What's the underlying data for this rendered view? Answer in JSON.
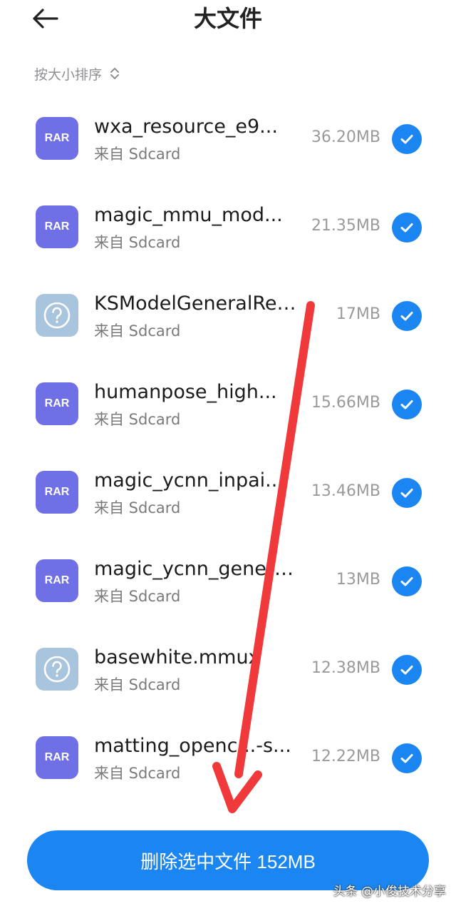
{
  "header": {
    "title": "大文件",
    "back_icon": "arrow-left-icon"
  },
  "sort": {
    "label": "按大小排序",
    "icon": "sort-updown-icon"
  },
  "files": [
    {
      "name": "wxa_resource_e9...",
      "source": "来自 Sdcard",
      "size": "36.20MB",
      "type": "rar",
      "icon_label": "RAR",
      "checked": true
    },
    {
      "name": "magic_mmu_mod...",
      "source": "来自 Sdcard",
      "size": "21.35MB",
      "type": "rar",
      "icon_label": "RAR",
      "checked": true
    },
    {
      "name": "KSModelGeneralRec...",
      "source": "来自 Sdcard",
      "size": "17MB",
      "type": "unknown",
      "icon_label": "",
      "checked": true
    },
    {
      "name": "humanpose_high...",
      "source": "来自 Sdcard",
      "size": "15.66MB",
      "type": "rar",
      "icon_label": "RAR",
      "checked": true
    },
    {
      "name": "magic_ycnn_inpai...",
      "source": "来自 Sdcard",
      "size": "13.46MB",
      "type": "rar",
      "icon_label": "RAR",
      "checked": true
    },
    {
      "name": "magic_ycnn_general...",
      "source": "来自 Sdcard",
      "size": "13MB",
      "type": "rar",
      "icon_label": "RAR",
      "checked": true
    },
    {
      "name": "basewhite.mmux",
      "source": "来自 Sdcard",
      "size": "12.38MB",
      "type": "unknown",
      "icon_label": "",
      "checked": true
    },
    {
      "name": "matting_openc...-s...",
      "source": "来自 Sdcard",
      "size": "12.22MB",
      "type": "rar",
      "icon_label": "RAR",
      "checked": true
    }
  ],
  "delete_button": {
    "label": "删除选中文件 152MB"
  },
  "watermark": "头条 @小俊技术分享",
  "colors": {
    "accent": "#1b86f2",
    "rar_icon": "#6f6fe6",
    "unknown_icon": "#a9c4dd",
    "annotation_arrow": "#f0393a"
  }
}
